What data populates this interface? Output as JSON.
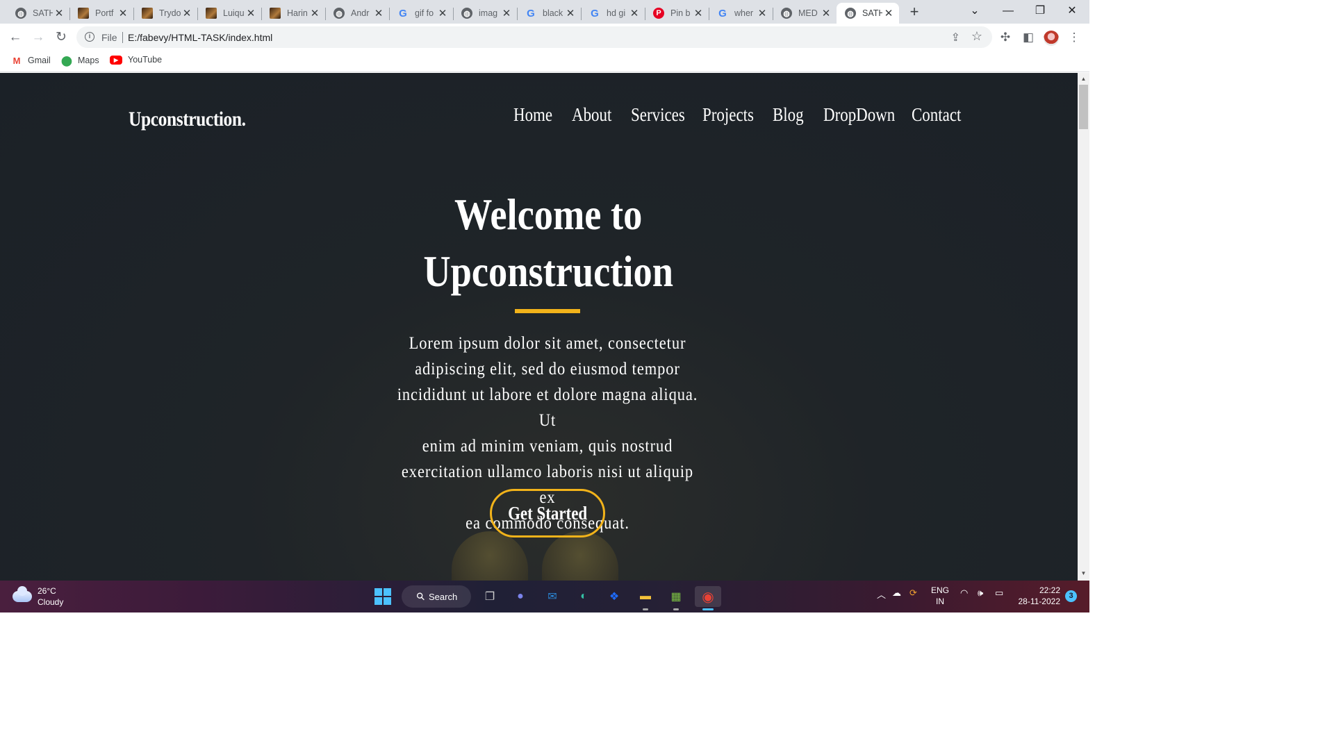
{
  "browser": {
    "tabs": [
      {
        "title": "SATH",
        "favicon": "globe-icon"
      },
      {
        "title": "Portf",
        "favicon": "image-icon"
      },
      {
        "title": "Trydo",
        "favicon": "image-icon"
      },
      {
        "title": "Luiqu",
        "favicon": "image-icon"
      },
      {
        "title": "Harin",
        "favicon": "image-icon"
      },
      {
        "title": "Andr",
        "favicon": "globe-icon"
      },
      {
        "title": "gif fo",
        "favicon": "google-icon"
      },
      {
        "title": "imag",
        "favicon": "globe-icon"
      },
      {
        "title": "black",
        "favicon": "google-icon"
      },
      {
        "title": "hd gi",
        "favicon": "google-icon"
      },
      {
        "title": "Pin b",
        "favicon": "pinterest-icon"
      },
      {
        "title": "wher",
        "favicon": "google-icon"
      },
      {
        "title": "MED",
        "favicon": "globe-icon"
      },
      {
        "title": "SATH",
        "favicon": "globe-icon",
        "active": true
      }
    ],
    "address": {
      "scheme_label": "File",
      "url": "E:/fabevy/HTML-TASK/index.html"
    },
    "bookmarks": [
      {
        "label": "Gmail",
        "icon": "gmail-icon"
      },
      {
        "label": "Maps",
        "icon": "maps-icon"
      },
      {
        "label": "YouTube",
        "icon": "youtube-icon"
      }
    ]
  },
  "site": {
    "logo": "Upconstruction.",
    "nav": [
      "Home",
      "About",
      "Services",
      "Projects",
      "Blog",
      "DropDown",
      "Contact"
    ],
    "hero": {
      "title_line1": "Welcome to",
      "title_line2": "Upconstruction",
      "text_lines": [
        "Lorem ipsum dolor sit amet, consectetur",
        "adipiscing elit, sed do eiusmod tempor",
        "incididunt ut labore et dolore magna aliqua. Ut",
        "enim ad minim veniam, quis nostrud",
        "exercitation ullamco laboris nisi ut aliquip ex",
        "ea commodo consequat."
      ],
      "cta": "Get Started"
    },
    "colors": {
      "background": "#1b2127",
      "accent": "#f2b31a",
      "text": "#ffffff"
    }
  },
  "taskbar": {
    "weather": {
      "temp": "26°C",
      "condition": "Cloudy"
    },
    "search_label": "Search",
    "language": {
      "line1": "ENG",
      "line2": "IN"
    },
    "clock": {
      "time": "22:22",
      "date": "28-11-2022"
    },
    "notifications": "3"
  }
}
